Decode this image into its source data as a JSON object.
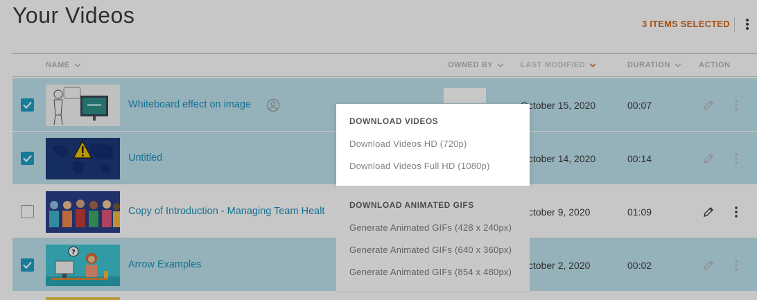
{
  "page": {
    "title": "Your Videos"
  },
  "selection": {
    "label": "3 ITEMS SELECTED",
    "more_icon": "kebab-vertical-icon"
  },
  "columns": {
    "name": "NAME",
    "owned_by": "OWNED BY",
    "last_modified": "LAST MODIFIED",
    "duration": "DURATION",
    "action": "ACTION"
  },
  "rows": [
    {
      "title": "Whiteboard effect on image",
      "modified": "October 15, 2020",
      "duration": "00:07",
      "selected": true,
      "shared_icon": "user-circle-icon"
    },
    {
      "title": "Untitled",
      "modified": "October 14, 2020",
      "duration": "00:14",
      "selected": true
    },
    {
      "title": "Copy of Introduction - Managing Team Healt",
      "modified": "October 9, 2020",
      "duration": "01:09",
      "selected": false
    },
    {
      "title": "Arrow Examples",
      "modified": "October 2, 2020",
      "duration": "00:02",
      "selected": true
    }
  ],
  "download_menu": {
    "videos_heading": "DOWNLOAD VIDEOS",
    "videos_items": [
      "Download Videos HD (720p)",
      "Download Videos Full HD (1080p)"
    ],
    "gifs_heading": "DOWNLOAD ANIMATED GIFS",
    "gifs_items": [
      "Generate Animated GIFs (428 x 240px)",
      "Generate Animated GIFs (640 x 360px)",
      "Generate Animated GIFs (854 x 480px)"
    ]
  },
  "colors": {
    "accent": "#1a9fc6",
    "selected_row": "#bfe3ee",
    "selection_text": "#d2691e",
    "link": "#1a93be"
  }
}
